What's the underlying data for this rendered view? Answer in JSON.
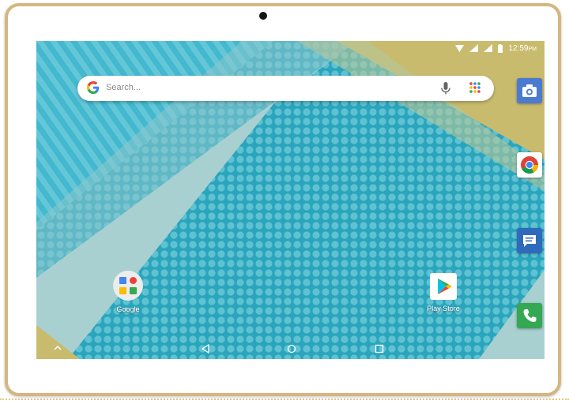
{
  "status_bar": {
    "time": "12:59",
    "ampm": "PM",
    "icons": [
      "wifi-icon",
      "signal-icon",
      "signal-icon",
      "battery-icon"
    ]
  },
  "search": {
    "placeholder": "Search...",
    "icons": [
      "google-g-icon",
      "mic-icon",
      "app-drawer-icon"
    ]
  },
  "dock": [
    {
      "name": "Camera",
      "icon": "camera-icon",
      "color": "#4a7bd0"
    },
    {
      "name": "Chrome",
      "icon": "chrome-icon",
      "color": "#ffffff"
    },
    {
      "name": "Messages",
      "icon": "messages-icon",
      "color": "#2f6bbd"
    },
    {
      "name": "Phone",
      "icon": "phone-icon",
      "color": "#35a853"
    }
  ],
  "home_apps": [
    {
      "label": "Google",
      "icon": "google-folder-icon"
    },
    {
      "label": "Play Store",
      "icon": "play-store-icon"
    }
  ],
  "nav_bar": {
    "buttons": [
      "back-icon",
      "home-icon",
      "recents-icon"
    ]
  },
  "colors": {
    "bezel": "#d4b680",
    "wallpaper_teal": "#2fa9bf",
    "wallpaper_gold": "#c9bb6e",
    "wallpaper_gray": "#a8cfcf"
  }
}
